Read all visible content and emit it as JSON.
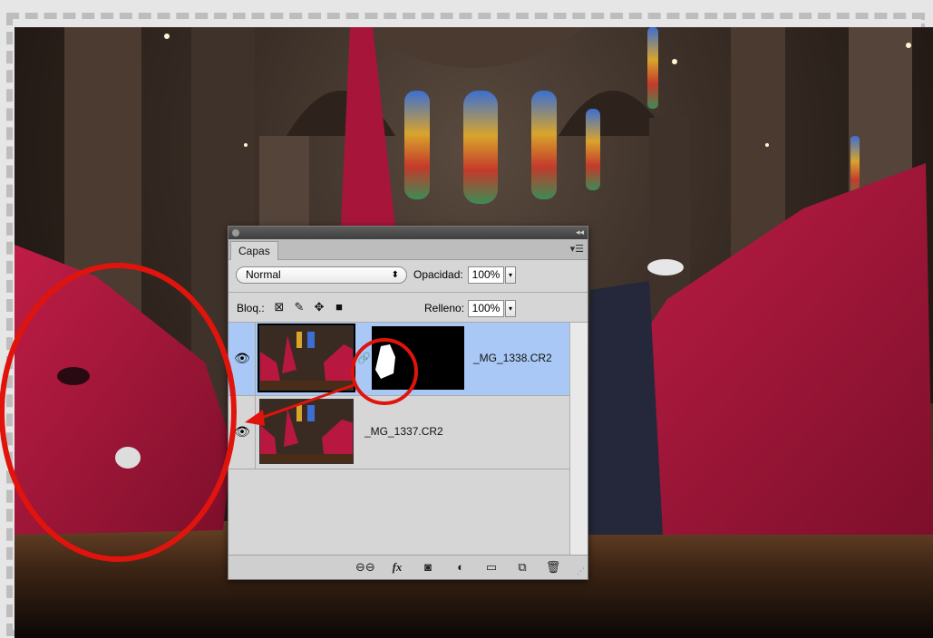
{
  "panel": {
    "tab_label": "Capas",
    "blend_mode": "Normal",
    "opacity_label": "Opacidad:",
    "opacity_value": "100%",
    "lock_label": "Bloq.:",
    "fill_label": "Relleno:",
    "fill_value": "100%",
    "layers": [
      {
        "name": "_MG_1338.CR2",
        "selected": true,
        "has_mask": true
      },
      {
        "name": "_MG_1337.CR2",
        "selected": false,
        "has_mask": false
      }
    ],
    "footer_icons": [
      "link-icon",
      "fx-icon",
      "mask-icon",
      "adjustment-icon",
      "folder-icon",
      "new-layer-icon",
      "trash-icon"
    ],
    "footer_fx": "fx"
  },
  "colors": {
    "annotation_red": "#e0140c",
    "robe": "#a8153a",
    "selection": "#a9c8f5"
  }
}
